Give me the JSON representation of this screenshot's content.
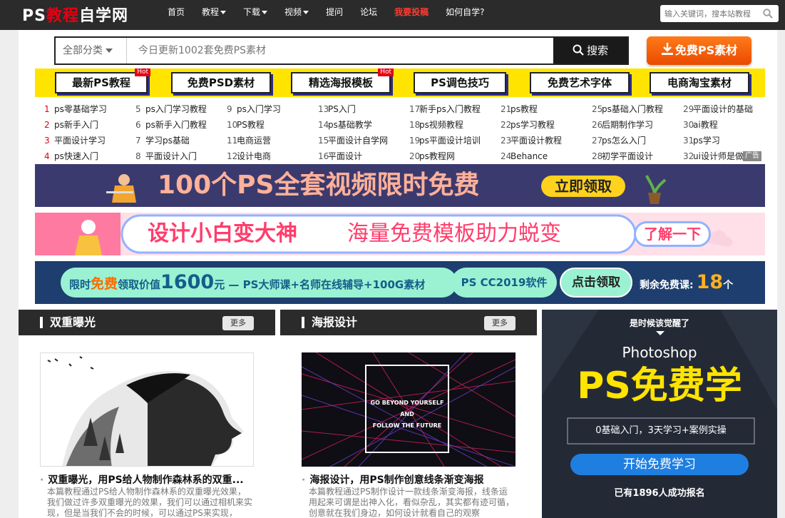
{
  "logo": {
    "prefix": "PS",
    "red": "教程",
    "suffix": "自学网"
  },
  "nav": {
    "items": [
      {
        "label": "首页",
        "caret": false,
        "highlight": false
      },
      {
        "label": "教程",
        "caret": true,
        "highlight": false
      },
      {
        "label": "下载",
        "caret": true,
        "highlight": false
      },
      {
        "label": "视频",
        "caret": true,
        "highlight": false
      },
      {
        "label": "提问",
        "caret": false,
        "highlight": false
      },
      {
        "label": "论坛",
        "caret": false,
        "highlight": false
      },
      {
        "label": "我要投稿",
        "caret": false,
        "highlight": true
      },
      {
        "label": "如何自学?",
        "caret": false,
        "highlight": false
      }
    ],
    "search_placeholder": "输入关键词，搜本站教程"
  },
  "search": {
    "category": "全部分类",
    "placeholder": "今日更新1002套免费PS素材",
    "button": "搜索"
  },
  "free_button": "免费PS素材",
  "tags": [
    {
      "label": "最新PS教程",
      "hot": true
    },
    {
      "label": "免费PSD素材",
      "hot": false
    },
    {
      "label": "精选海报模板",
      "hot": true
    },
    {
      "label": "PS调色技巧",
      "hot": false
    },
    {
      "label": "免费艺术字体",
      "hot": false
    },
    {
      "label": "电商淘宝素材",
      "hot": false
    }
  ],
  "hot_label": "Hot",
  "keywords": [
    [
      [
        "1",
        "ps零基础学习"
      ],
      [
        "5",
        "ps入门学习教程"
      ],
      [
        "9",
        "ps入门学习"
      ],
      [
        "13",
        "PS入门"
      ],
      [
        "17",
        "新手ps入门教程"
      ],
      [
        "21",
        "ps教程"
      ],
      [
        "25",
        "ps基础入门教程"
      ],
      [
        "29",
        "平面设计的基础"
      ]
    ],
    [
      [
        "2",
        "ps新手入门"
      ],
      [
        "6",
        "ps新手入门教程"
      ],
      [
        "10",
        "PS教程"
      ],
      [
        "14",
        "ps基础教学"
      ],
      [
        "18",
        "ps视频教程"
      ],
      [
        "22",
        "ps学习教程"
      ],
      [
        "26",
        "后期制作学习"
      ],
      [
        "30",
        "ai教程"
      ]
    ],
    [
      [
        "3",
        "平面设计学习"
      ],
      [
        "7",
        "学习ps基础"
      ],
      [
        "11",
        "电商运营"
      ],
      [
        "15",
        "平面设计自学网"
      ],
      [
        "19",
        "ps平面设计培训"
      ],
      [
        "23",
        "平面设计教程"
      ],
      [
        "27",
        "ps怎么入门"
      ],
      [
        "31",
        "ps学习"
      ]
    ],
    [
      [
        "4",
        "ps快速入门"
      ],
      [
        "8",
        "平面设计入门"
      ],
      [
        "12",
        "设计电商"
      ],
      [
        "16",
        "平面设计"
      ],
      [
        "20",
        "ps教程网"
      ],
      [
        "24",
        "Behance"
      ],
      [
        "28",
        "初学平面设计"
      ],
      [
        "32",
        "ui设计师是做什"
      ]
    ]
  ],
  "ad_tag": "广告",
  "banners": {
    "b1_text": "100个PS全套视频限时免费",
    "b1_button": "立即领取",
    "b2_text_a": "设计小白变大神",
    "b2_text_b": "海量免费模板助力蜕变",
    "b2_button": "了解一下",
    "b3_a": "限时",
    "b3_b": "免费",
    "b3_c": "领取价值",
    "b3_d": "1600",
    "b3_e": "元 — PS大师课+名师在线辅导+100G素材",
    "b3_f": "PS CC2019软件",
    "b3_g": "点击领取",
    "b3_h": "剩余免费课:",
    "b3_i": "18",
    "b3_j": "个"
  },
  "panels": [
    {
      "title": "双重曝光",
      "more": "更多",
      "article_title": "双重曝光，用PS给人物制作森林系的双重...",
      "desc": "本篇教程通过PS给人物制作森林系的双重曝光效果，我们做过许多双重曝光的效果，我们可以通过相机来实现，但是当我们不会的时候，可以通过PS来实现，"
    },
    {
      "title": "海报设计",
      "more": "更多",
      "article_title": "海报设计，用PS制作创意线条渐变海报",
      "desc": "本篇教程通过PS制作设计一款线条渐变海报，线条运用起来可谓是出神入化，看似杂乱，其实都有迹可循，创意就在我们身边，如何设计就看自己的观察",
      "poster_line1": "GO BEYOND YOURSELF",
      "poster_line2": "AND",
      "poster_line3": "FOLLOW THE FUTURE"
    }
  ],
  "side_ad": {
    "top": "是时候该觉醒了",
    "brand": "Photoshop",
    "headline": "PS免费学",
    "sub": "0基础入门，3天学习+案例实操",
    "button": "开始免费学习",
    "footer": "已有1896人成功报名"
  },
  "colors": {
    "accent_red": "#e60012",
    "orange": "#ff6a00",
    "yellow": "#ffe400",
    "dark": "#2b2b2b"
  }
}
